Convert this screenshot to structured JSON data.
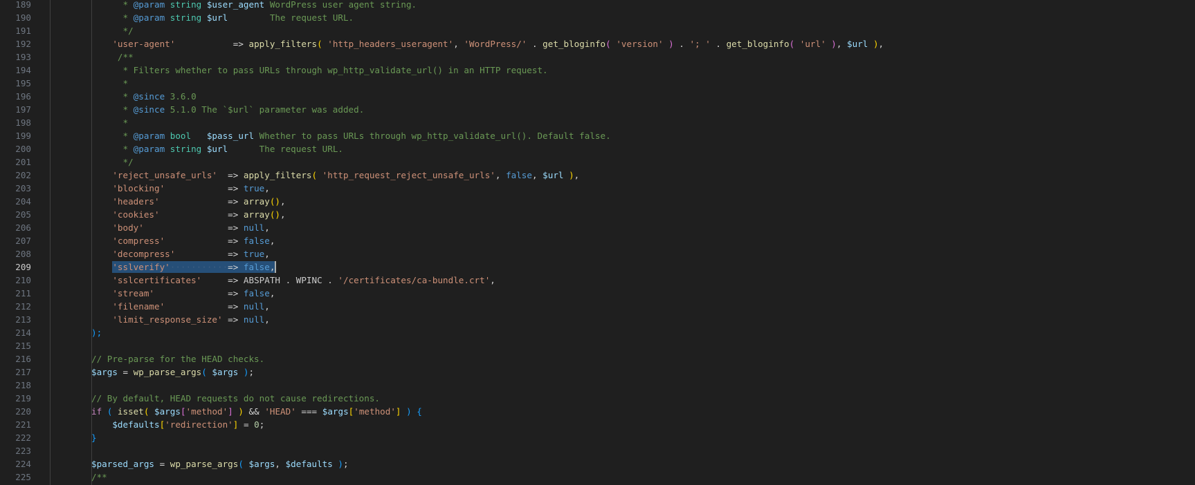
{
  "editor": {
    "active_line": 209,
    "colors": {
      "background": "#1f1f1f",
      "line_number": "#6e7681",
      "active_line_number": "#cccccc",
      "selection": "#264f78",
      "comment": "#6a9955",
      "string": "#ce9178",
      "variable": "#9cdcfe",
      "function": "#dcdcaa",
      "constant": "#569cd6"
    },
    "lines": [
      {
        "n": "189",
        "t": [
          [
            "comment",
            "      * "
          ],
          [
            "doctag",
            "@param"
          ],
          [
            "doctype",
            " string"
          ],
          [
            "docvar",
            " $user_agent"
          ],
          [
            "comment",
            " WordPress user agent string."
          ]
        ]
      },
      {
        "n": "190",
        "t": [
          [
            "comment",
            "      * "
          ],
          [
            "doctag",
            "@param"
          ],
          [
            "doctype",
            " string"
          ],
          [
            "docvar",
            " $url"
          ],
          [
            "comment",
            "        The request URL."
          ]
        ]
      },
      {
        "n": "191",
        "t": [
          [
            "comment",
            "      */"
          ]
        ]
      },
      {
        "n": "192",
        "t": [
          [
            "plain",
            "    "
          ],
          [
            "string",
            "'user-agent'"
          ],
          [
            "plain",
            "           "
          ],
          [
            "op",
            "=> "
          ],
          [
            "func",
            "apply_filters"
          ],
          [
            "b1",
            "( "
          ],
          [
            "string",
            "'http_headers_useragent'"
          ],
          [
            "op",
            ", "
          ],
          [
            "string",
            "'WordPress/'"
          ],
          [
            "op",
            " . "
          ],
          [
            "func",
            "get_bloginfo"
          ],
          [
            "b2",
            "( "
          ],
          [
            "string",
            "'version'"
          ],
          [
            "b2",
            " )"
          ],
          [
            "op",
            " . "
          ],
          [
            "string",
            "'; '"
          ],
          [
            "op",
            " . "
          ],
          [
            "func",
            "get_bloginfo"
          ],
          [
            "b2",
            "( "
          ],
          [
            "string",
            "'url'"
          ],
          [
            "b2",
            " )"
          ],
          [
            "op",
            ", "
          ],
          [
            "var",
            "$url"
          ],
          [
            "b1",
            " )"
          ],
          [
            "op",
            ","
          ]
        ]
      },
      {
        "n": "193",
        "t": [
          [
            "comment",
            "     /**"
          ]
        ]
      },
      {
        "n": "194",
        "t": [
          [
            "comment",
            "      * Filters whether to pass URLs through wp_http_validate_url() in an HTTP request."
          ]
        ]
      },
      {
        "n": "195",
        "t": [
          [
            "comment",
            "      *"
          ]
        ]
      },
      {
        "n": "196",
        "t": [
          [
            "comment",
            "      * "
          ],
          [
            "doctag",
            "@since"
          ],
          [
            "comment",
            " 3.6.0"
          ]
        ]
      },
      {
        "n": "197",
        "t": [
          [
            "comment",
            "      * "
          ],
          [
            "doctag",
            "@since"
          ],
          [
            "comment",
            " 5.1.0 The `$url` parameter was added."
          ]
        ]
      },
      {
        "n": "198",
        "t": [
          [
            "comment",
            "      *"
          ]
        ]
      },
      {
        "n": "199",
        "t": [
          [
            "comment",
            "      * "
          ],
          [
            "doctag",
            "@param"
          ],
          [
            "doctype",
            " bool"
          ],
          [
            "docvar",
            "   $pass_url"
          ],
          [
            "comment",
            " Whether to pass URLs through wp_http_validate_url(). Default false."
          ]
        ]
      },
      {
        "n": "200",
        "t": [
          [
            "comment",
            "      * "
          ],
          [
            "doctag",
            "@param"
          ],
          [
            "doctype",
            " string"
          ],
          [
            "docvar",
            " $url"
          ],
          [
            "comment",
            "      The request URL."
          ]
        ]
      },
      {
        "n": "201",
        "t": [
          [
            "comment",
            "      */"
          ]
        ]
      },
      {
        "n": "202",
        "t": [
          [
            "plain",
            "    "
          ],
          [
            "string",
            "'reject_unsafe_urls'"
          ],
          [
            "plain",
            "  "
          ],
          [
            "op",
            "=> "
          ],
          [
            "func",
            "apply_filters"
          ],
          [
            "b1",
            "( "
          ],
          [
            "string",
            "'http_request_reject_unsafe_urls'"
          ],
          [
            "op",
            ", "
          ],
          [
            "const",
            "false"
          ],
          [
            "op",
            ", "
          ],
          [
            "var",
            "$url"
          ],
          [
            "b1",
            " )"
          ],
          [
            "op",
            ","
          ]
        ]
      },
      {
        "n": "203",
        "t": [
          [
            "plain",
            "    "
          ],
          [
            "string",
            "'blocking'"
          ],
          [
            "plain",
            "            "
          ],
          [
            "op",
            "=> "
          ],
          [
            "const",
            "true"
          ],
          [
            "op",
            ","
          ]
        ]
      },
      {
        "n": "204",
        "t": [
          [
            "plain",
            "    "
          ],
          [
            "string",
            "'headers'"
          ],
          [
            "plain",
            "             "
          ],
          [
            "op",
            "=> "
          ],
          [
            "func",
            "array"
          ],
          [
            "b1",
            "()"
          ],
          [
            "op",
            ","
          ]
        ]
      },
      {
        "n": "205",
        "t": [
          [
            "plain",
            "    "
          ],
          [
            "string",
            "'cookies'"
          ],
          [
            "plain",
            "             "
          ],
          [
            "op",
            "=> "
          ],
          [
            "func",
            "array"
          ],
          [
            "b1",
            "()"
          ],
          [
            "op",
            ","
          ]
        ]
      },
      {
        "n": "206",
        "t": [
          [
            "plain",
            "    "
          ],
          [
            "string",
            "'body'"
          ],
          [
            "plain",
            "                "
          ],
          [
            "op",
            "=> "
          ],
          [
            "const",
            "null"
          ],
          [
            "op",
            ","
          ]
        ]
      },
      {
        "n": "207",
        "t": [
          [
            "plain",
            "    "
          ],
          [
            "string",
            "'compress'"
          ],
          [
            "plain",
            "            "
          ],
          [
            "op",
            "=> "
          ],
          [
            "const",
            "false"
          ],
          [
            "op",
            ","
          ]
        ]
      },
      {
        "n": "208",
        "t": [
          [
            "plain",
            "    "
          ],
          [
            "string",
            "'decompress'"
          ],
          [
            "plain",
            "          "
          ],
          [
            "op",
            "=> "
          ],
          [
            "const",
            "true"
          ],
          [
            "op",
            ","
          ]
        ]
      },
      {
        "n": "209",
        "t": [
          [
            "plain",
            "    "
          ],
          [
            "string",
            "'sslverify'"
          ],
          [
            "dots",
            "···········"
          ],
          [
            "op",
            "=> "
          ],
          [
            "const",
            "false"
          ],
          [
            "op",
            ","
          ]
        ]
      },
      {
        "n": "210",
        "t": [
          [
            "plain",
            "    "
          ],
          [
            "string",
            "'sslcertificates'"
          ],
          [
            "plain",
            "     "
          ],
          [
            "op",
            "=> "
          ],
          [
            "plain",
            "ABSPATH . WPINC . "
          ],
          [
            "string",
            "'/certificates/ca-bundle.crt'"
          ],
          [
            "op",
            ","
          ]
        ]
      },
      {
        "n": "211",
        "t": [
          [
            "plain",
            "    "
          ],
          [
            "string",
            "'stream'"
          ],
          [
            "plain",
            "              "
          ],
          [
            "op",
            "=> "
          ],
          [
            "const",
            "false"
          ],
          [
            "op",
            ","
          ]
        ]
      },
      {
        "n": "212",
        "t": [
          [
            "plain",
            "    "
          ],
          [
            "string",
            "'filename'"
          ],
          [
            "plain",
            "            "
          ],
          [
            "op",
            "=> "
          ],
          [
            "const",
            "null"
          ],
          [
            "op",
            ","
          ]
        ]
      },
      {
        "n": "213",
        "t": [
          [
            "plain",
            "    "
          ],
          [
            "string",
            "'limit_response_size'"
          ],
          [
            "plain",
            " "
          ],
          [
            "op",
            "=> "
          ],
          [
            "const",
            "null"
          ],
          [
            "op",
            ","
          ]
        ]
      },
      {
        "n": "214",
        "t": [
          [
            "b3",
            ");"
          ]
        ]
      },
      {
        "n": "215",
        "t": []
      },
      {
        "n": "216",
        "t": [
          [
            "comment",
            "// Pre-parse for the HEAD checks."
          ]
        ]
      },
      {
        "n": "217",
        "t": [
          [
            "var",
            "$args"
          ],
          [
            "op",
            " = "
          ],
          [
            "func",
            "wp_parse_args"
          ],
          [
            "b3",
            "( "
          ],
          [
            "var",
            "$args"
          ],
          [
            "b3",
            " )"
          ],
          [
            "op",
            ";"
          ]
        ]
      },
      {
        "n": "218",
        "t": []
      },
      {
        "n": "219",
        "t": [
          [
            "comment",
            "// By default, HEAD requests do not cause redirections."
          ]
        ]
      },
      {
        "n": "220",
        "t": [
          [
            "keyword",
            "if"
          ],
          [
            "b3",
            " ( "
          ],
          [
            "func",
            "isset"
          ],
          [
            "b1",
            "( "
          ],
          [
            "var",
            "$args"
          ],
          [
            "b2",
            "["
          ],
          [
            "string",
            "'method'"
          ],
          [
            "b2",
            "]"
          ],
          [
            "b1",
            " )"
          ],
          [
            "op",
            " && "
          ],
          [
            "string",
            "'HEAD'"
          ],
          [
            "op",
            " === "
          ],
          [
            "var",
            "$args"
          ],
          [
            "b1",
            "["
          ],
          [
            "string",
            "'method'"
          ],
          [
            "b1",
            "]"
          ],
          [
            "b3",
            " ) {"
          ]
        ]
      },
      {
        "n": "221",
        "t": [
          [
            "plain",
            "    "
          ],
          [
            "var",
            "$defaults"
          ],
          [
            "b1",
            "["
          ],
          [
            "string",
            "'redirection'"
          ],
          [
            "b1",
            "]"
          ],
          [
            "op",
            " = "
          ],
          [
            "num",
            "0"
          ],
          [
            "op",
            ";"
          ]
        ]
      },
      {
        "n": "222",
        "t": [
          [
            "b3",
            "}"
          ]
        ]
      },
      {
        "n": "223",
        "t": []
      },
      {
        "n": "224",
        "t": [
          [
            "var",
            "$parsed_args"
          ],
          [
            "op",
            " = "
          ],
          [
            "func",
            "wp_parse_args"
          ],
          [
            "b3",
            "( "
          ],
          [
            "var",
            "$args"
          ],
          [
            "op",
            ", "
          ],
          [
            "var",
            "$defaults"
          ],
          [
            "b3",
            " )"
          ],
          [
            "op",
            ";"
          ]
        ]
      },
      {
        "n": "225",
        "t": [
          [
            "comment",
            "/**"
          ]
        ]
      }
    ]
  }
}
